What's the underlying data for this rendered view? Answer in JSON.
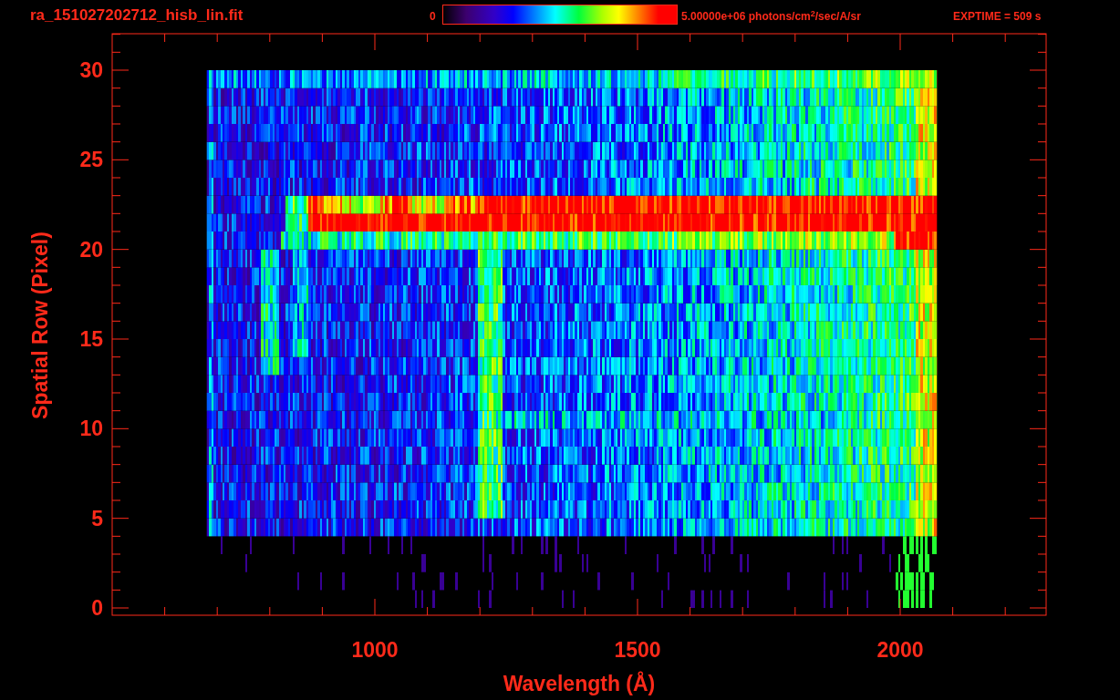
{
  "header": {
    "file_name": "ra_151027202712_hisb_lin.fit",
    "colorbar_min": "0",
    "colorbar_max": "5.00000e+06 photons/cm$^{2}$/sec/A/sr",
    "exposure": "EXPTIME = 509 s"
  },
  "plot": {
    "xlabel": "Wavelength (Å)",
    "ylabel": "Spatial Row (Pixel)",
    "xticks": [
      "1000",
      "1500",
      "2000"
    ],
    "yticks": [
      "30",
      "25",
      "20",
      "15",
      "10",
      "5",
      "0"
    ]
  }
}
